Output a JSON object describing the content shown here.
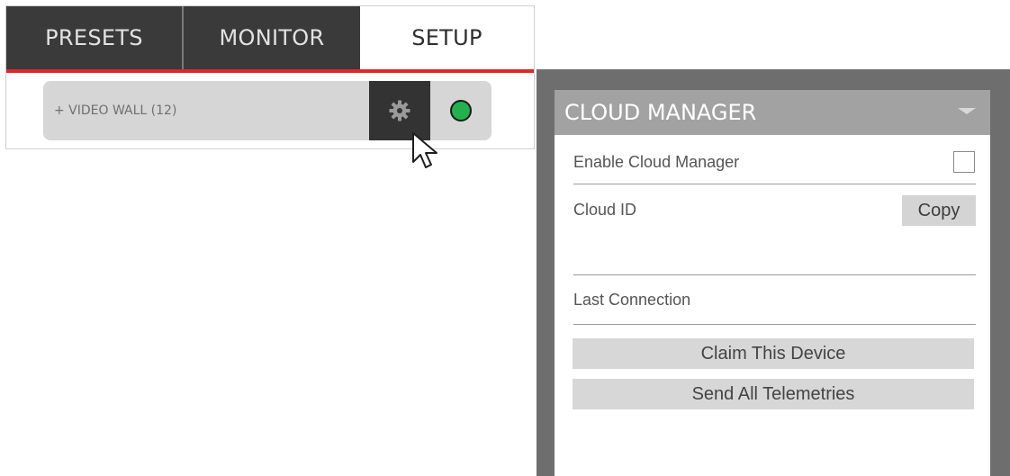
{
  "tabs": [
    {
      "label": "PRESETS"
    },
    {
      "label": "MONITOR"
    },
    {
      "label": "SETUP"
    }
  ],
  "active_tab": "SETUP",
  "accent_color": "#e0262b",
  "device_row": {
    "label": "+ VIDEO WALL (12)",
    "settings_icon": "gear-icon",
    "status_color": "#22b14c"
  },
  "cloud_manager": {
    "title": "CLOUD MANAGER",
    "enable_label": "Enable Cloud Manager",
    "enable_checked": false,
    "cloud_id_label": "Cloud ID",
    "cloud_id_value": "",
    "copy_label": "Copy",
    "last_connection_label": "Last Connection",
    "claim_label": "Claim This Device",
    "telemetry_label": "Send All Telemetries"
  }
}
